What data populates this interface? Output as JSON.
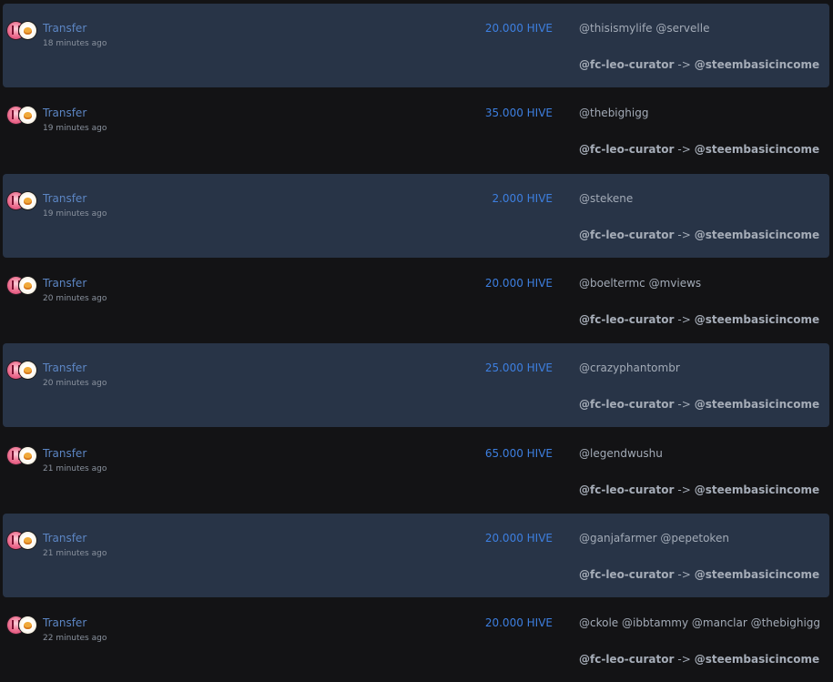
{
  "transactions": [
    {
      "type": "Transfer",
      "time": "18 minutes ago",
      "amount": "20.000 HIVE",
      "memo": "@thisismylife @servelle",
      "from": "@fc-leo-curator",
      "arrow": "->",
      "to": "@steembasicincome"
    },
    {
      "type": "Transfer",
      "time": "19 minutes ago",
      "amount": "35.000 HIVE",
      "memo": "@thebighigg",
      "from": "@fc-leo-curator",
      "arrow": "->",
      "to": "@steembasicincome"
    },
    {
      "type": "Transfer",
      "time": "19 minutes ago",
      "amount": "2.000 HIVE",
      "memo": "@stekene",
      "from": "@fc-leo-curator",
      "arrow": "->",
      "to": "@steembasicincome"
    },
    {
      "type": "Transfer",
      "time": "20 minutes ago",
      "amount": "20.000 HIVE",
      "memo": "@boeltermc @mviews",
      "from": "@fc-leo-curator",
      "arrow": "->",
      "to": "@steembasicincome"
    },
    {
      "type": "Transfer",
      "time": "20 minutes ago",
      "amount": "25.000 HIVE",
      "memo": "@crazyphantombr",
      "from": "@fc-leo-curator",
      "arrow": "->",
      "to": "@steembasicincome"
    },
    {
      "type": "Transfer",
      "time": "21 minutes ago",
      "amount": "65.000 HIVE",
      "memo": "@legendwushu",
      "from": "@fc-leo-curator",
      "arrow": "->",
      "to": "@steembasicincome"
    },
    {
      "type": "Transfer",
      "time": "21 minutes ago",
      "amount": "20.000 HIVE",
      "memo": "@ganjafarmer @pepetoken",
      "from": "@fc-leo-curator",
      "arrow": "->",
      "to": "@steembasicincome"
    },
    {
      "type": "Transfer",
      "time": "22 minutes ago",
      "amount": "20.000 HIVE",
      "memo": "@ckole @ibbtammy @manclar @thebighigg",
      "from": "@fc-leo-curator",
      "arrow": "->",
      "to": "@steembasicincome"
    }
  ],
  "colors": {
    "shaded_row": "#283447",
    "link": "#5c86c4",
    "amount": "#3d7fe0",
    "text": "#a3abb7",
    "background": "#131315"
  }
}
